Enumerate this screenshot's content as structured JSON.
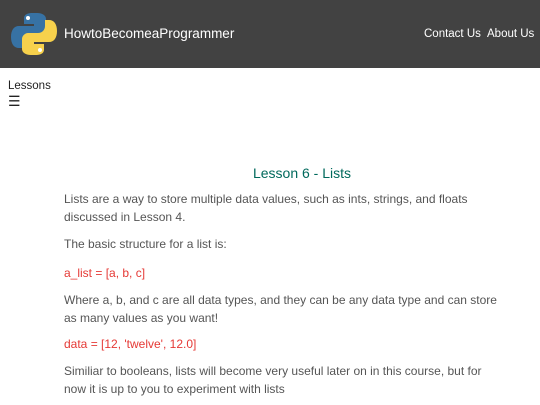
{
  "navbar": {
    "brand": "HowtoBecomeaProgrammer",
    "links": [
      "Contact Us",
      "About Us"
    ],
    "logo_colors": {
      "blue": "#3772a4",
      "yellow": "#f7d14c"
    }
  },
  "sidebar": {
    "label": "Lessons",
    "menu_icon": "☰"
  },
  "lesson": {
    "title": "Lesson 6 - Lists",
    "p1": "Lists are a way to store multiple data values, such as ints, strings, and floats discussed in Lesson 4.",
    "p2": "The basic structure for a list is:",
    "code1": "a_list = [a, b, c]",
    "p3": "Where a, b, and c are all data types, and they can be any data type and can store as many values as you want!",
    "code2": "data = [12, 'twelve', 12.0]",
    "p4": "Similiar to booleans, lists will become very useful later on in this course, but for now it is up to you to experiment with lists"
  }
}
